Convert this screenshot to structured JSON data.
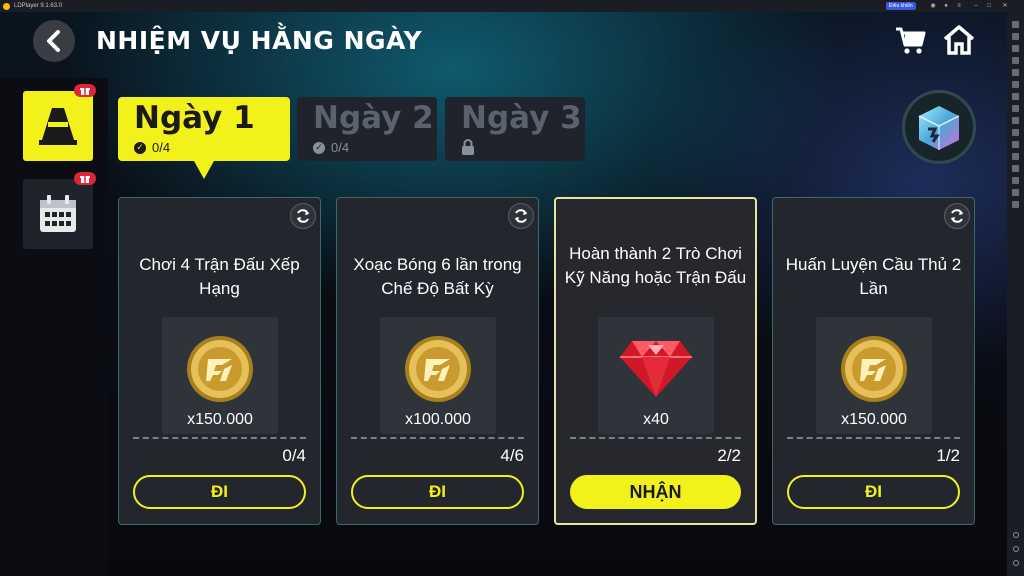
{
  "emulator": {
    "title": "LDPlayer 9.1.63.0",
    "control_label": "Điều khiển"
  },
  "header": {
    "title": "NHIỆM VỤ HẰNG NGÀY",
    "back_icon": "chevron-left-icon",
    "cart_icon": "cart-icon",
    "home_icon": "home-icon"
  },
  "side_tabs": [
    {
      "icon": "cone-icon",
      "active": true,
      "badge_icon": "gift-icon"
    },
    {
      "icon": "calendar-icon",
      "active": false,
      "badge_icon": "gift-icon"
    }
  ],
  "days": [
    {
      "label": "Ngày 1",
      "status": "0/4",
      "status_icon": "check-circle-icon",
      "active": true
    },
    {
      "label": "Ngày 2",
      "status": "0/4",
      "status_icon": "check-circle-icon",
      "active": false
    },
    {
      "label": "Ngày 3",
      "status_icon": "lock-icon",
      "locked": true
    }
  ],
  "chest_icon": "reward-chest-icon",
  "quests": [
    {
      "title": "Chơi 4 Trận Đấu Xếp Hạng",
      "reward_icon": "coin-icon",
      "reward": "x150.000",
      "progress": "0/4",
      "button": "ĐI",
      "completed": false
    },
    {
      "title": "Xoạc Bóng 6 lần trong Chế Độ Bất Kỳ",
      "reward_icon": "coin-icon",
      "reward": "x100.000",
      "progress": "4/6",
      "button": "ĐI",
      "completed": false
    },
    {
      "title": "Hoàn thành 2 Trò Chơi Kỹ Năng hoặc Trận Đấu",
      "reward_icon": "gem-icon",
      "reward": "x40",
      "progress": "2/2",
      "button": "NHẬN",
      "completed": true
    },
    {
      "title": "Huấn Luyện Cầu Thủ 2 Lần",
      "reward_icon": "coin-icon",
      "reward": "x150.000",
      "progress": "1/2",
      "button": "ĐI",
      "completed": false
    }
  ],
  "colors": {
    "accent_yellow": "#f2f21a",
    "card_bg": "#23262d",
    "card_border": "#3a6a6a",
    "badge_red": "#e0243a"
  }
}
